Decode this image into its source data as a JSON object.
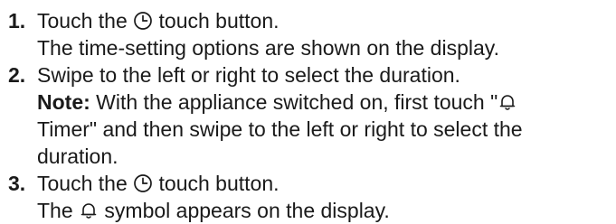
{
  "steps": [
    {
      "number": "1.",
      "instruction_pre": "Touch the",
      "instruction_icon": "timer-clock-icon",
      "instruction_post": "touch button.",
      "result": "The time-setting options are shown on the display."
    },
    {
      "number": "2.",
      "instruction": "Swipe to the left or right to select the duration.",
      "note_label": "Note:",
      "note_line1_pre": "With the appliance switched on, first touch \"",
      "note_icon": "bell-icon",
      "note_line2": "Timer\" and then swipe to the left or right to select the",
      "note_line3": "duration."
    },
    {
      "number": "3.",
      "instruction_pre": "Touch the",
      "instruction_icon": "timer-clock-icon",
      "instruction_post": "touch button.",
      "result_pre": "The",
      "result_icon": "bell-icon",
      "result_post": "symbol appears on the display."
    }
  ]
}
